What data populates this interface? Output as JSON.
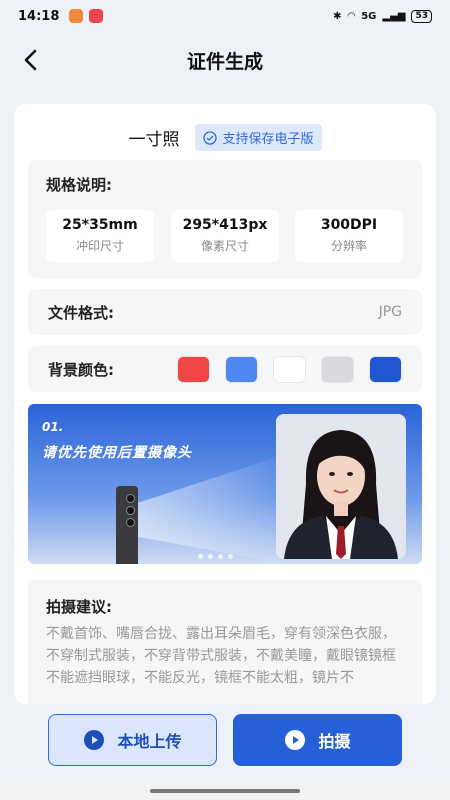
{
  "status_bar": {
    "time": "14:18",
    "battery": "53",
    "network": "5G"
  },
  "header": {
    "title": "证件生成"
  },
  "photo_type": {
    "size_label": "一寸照",
    "badge": "支持保存电子版"
  },
  "spec": {
    "label": "规格说明:",
    "items": [
      {
        "value": "25*35mm",
        "caption": "冲印尺寸"
      },
      {
        "value": "295*413px",
        "caption": "像素尺寸"
      },
      {
        "value": "300DPI",
        "caption": "分辨率"
      }
    ]
  },
  "format": {
    "label": "文件格式:",
    "value": "JPG"
  },
  "background": {
    "label": "背景颜色:",
    "colors": [
      "#ee4545",
      "#4d88f0",
      "#ffffff",
      "#d9dadd",
      "#2056d1"
    ]
  },
  "banner": {
    "step": "01.",
    "caption": "请优先使用后置摄像头"
  },
  "tips": {
    "label": "拍摄建议:",
    "text": "不戴首饰、嘴唇合拢、露出耳朵眉毛，穿有领深色衣服，不穿制式服装，不穿背带式服装，不戴美瞳，戴眼镜镜框不能遮挡眼球，不能反光，镜框不能太粗，镜片不"
  },
  "actions": {
    "local_upload": "本地上传",
    "shoot": "拍摄"
  },
  "colors": {
    "primary": "#2560d8",
    "badge_bg": "#dde8fb"
  }
}
